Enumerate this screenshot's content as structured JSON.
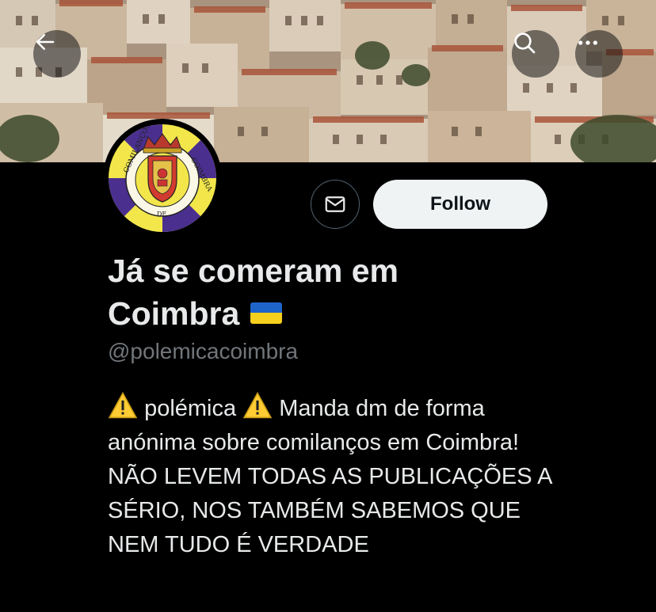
{
  "profile": {
    "name": "Já se comeram em Coimbra",
    "handle": "@polemicacoimbra",
    "bio_word1": "polémica",
    "bio_rest": "Manda dm de forma anónima sobre comilanços em Coimbra! NÃO LEVEM TODAS AS PUBLICAÇÕES A SÉRIO, NOS TAMBÉM SABEMOS QUE NEM TUDO É VERDADE"
  },
  "avatar": {
    "seal_text_left": "COMILANÇOS",
    "seal_text_right": "COIMBRA",
    "seal_text_bottom": "DE"
  },
  "actions": {
    "follow_label": "Follow"
  },
  "icons": {
    "back": "arrow-left-icon",
    "search": "search-icon",
    "more": "more-horizontal-icon",
    "message": "envelope-icon",
    "flag": "ukraine-flag-icon",
    "warning": "warning-icon"
  },
  "colors": {
    "background": "#000000",
    "text": "#e7e9ea",
    "secondary_text": "#71767b",
    "follow_bg": "#eff3f4",
    "avatar_purple": "#4a2f8f",
    "avatar_yellow": "#f2e64a"
  }
}
